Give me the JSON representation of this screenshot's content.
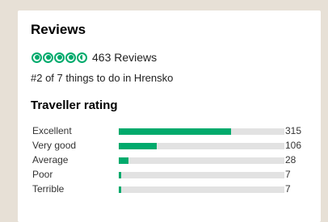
{
  "reviews": {
    "title": "Reviews",
    "bubble_rating": 4.5,
    "review_count": "463 Reviews",
    "rank": "#2 of 7 things to do in Hrensko"
  },
  "traveller_rating": {
    "title": "Traveller rating",
    "accent_color": "#00aa6c",
    "rows": [
      {
        "label": "Excellent",
        "count": "315",
        "value": 315
      },
      {
        "label": "Very good",
        "count": "106",
        "value": 106
      },
      {
        "label": "Average",
        "count": "28",
        "value": 28
      },
      {
        "label": "Poor",
        "count": "7",
        "value": 7
      },
      {
        "label": "Terrible",
        "count": "7",
        "value": 7
      }
    ]
  }
}
